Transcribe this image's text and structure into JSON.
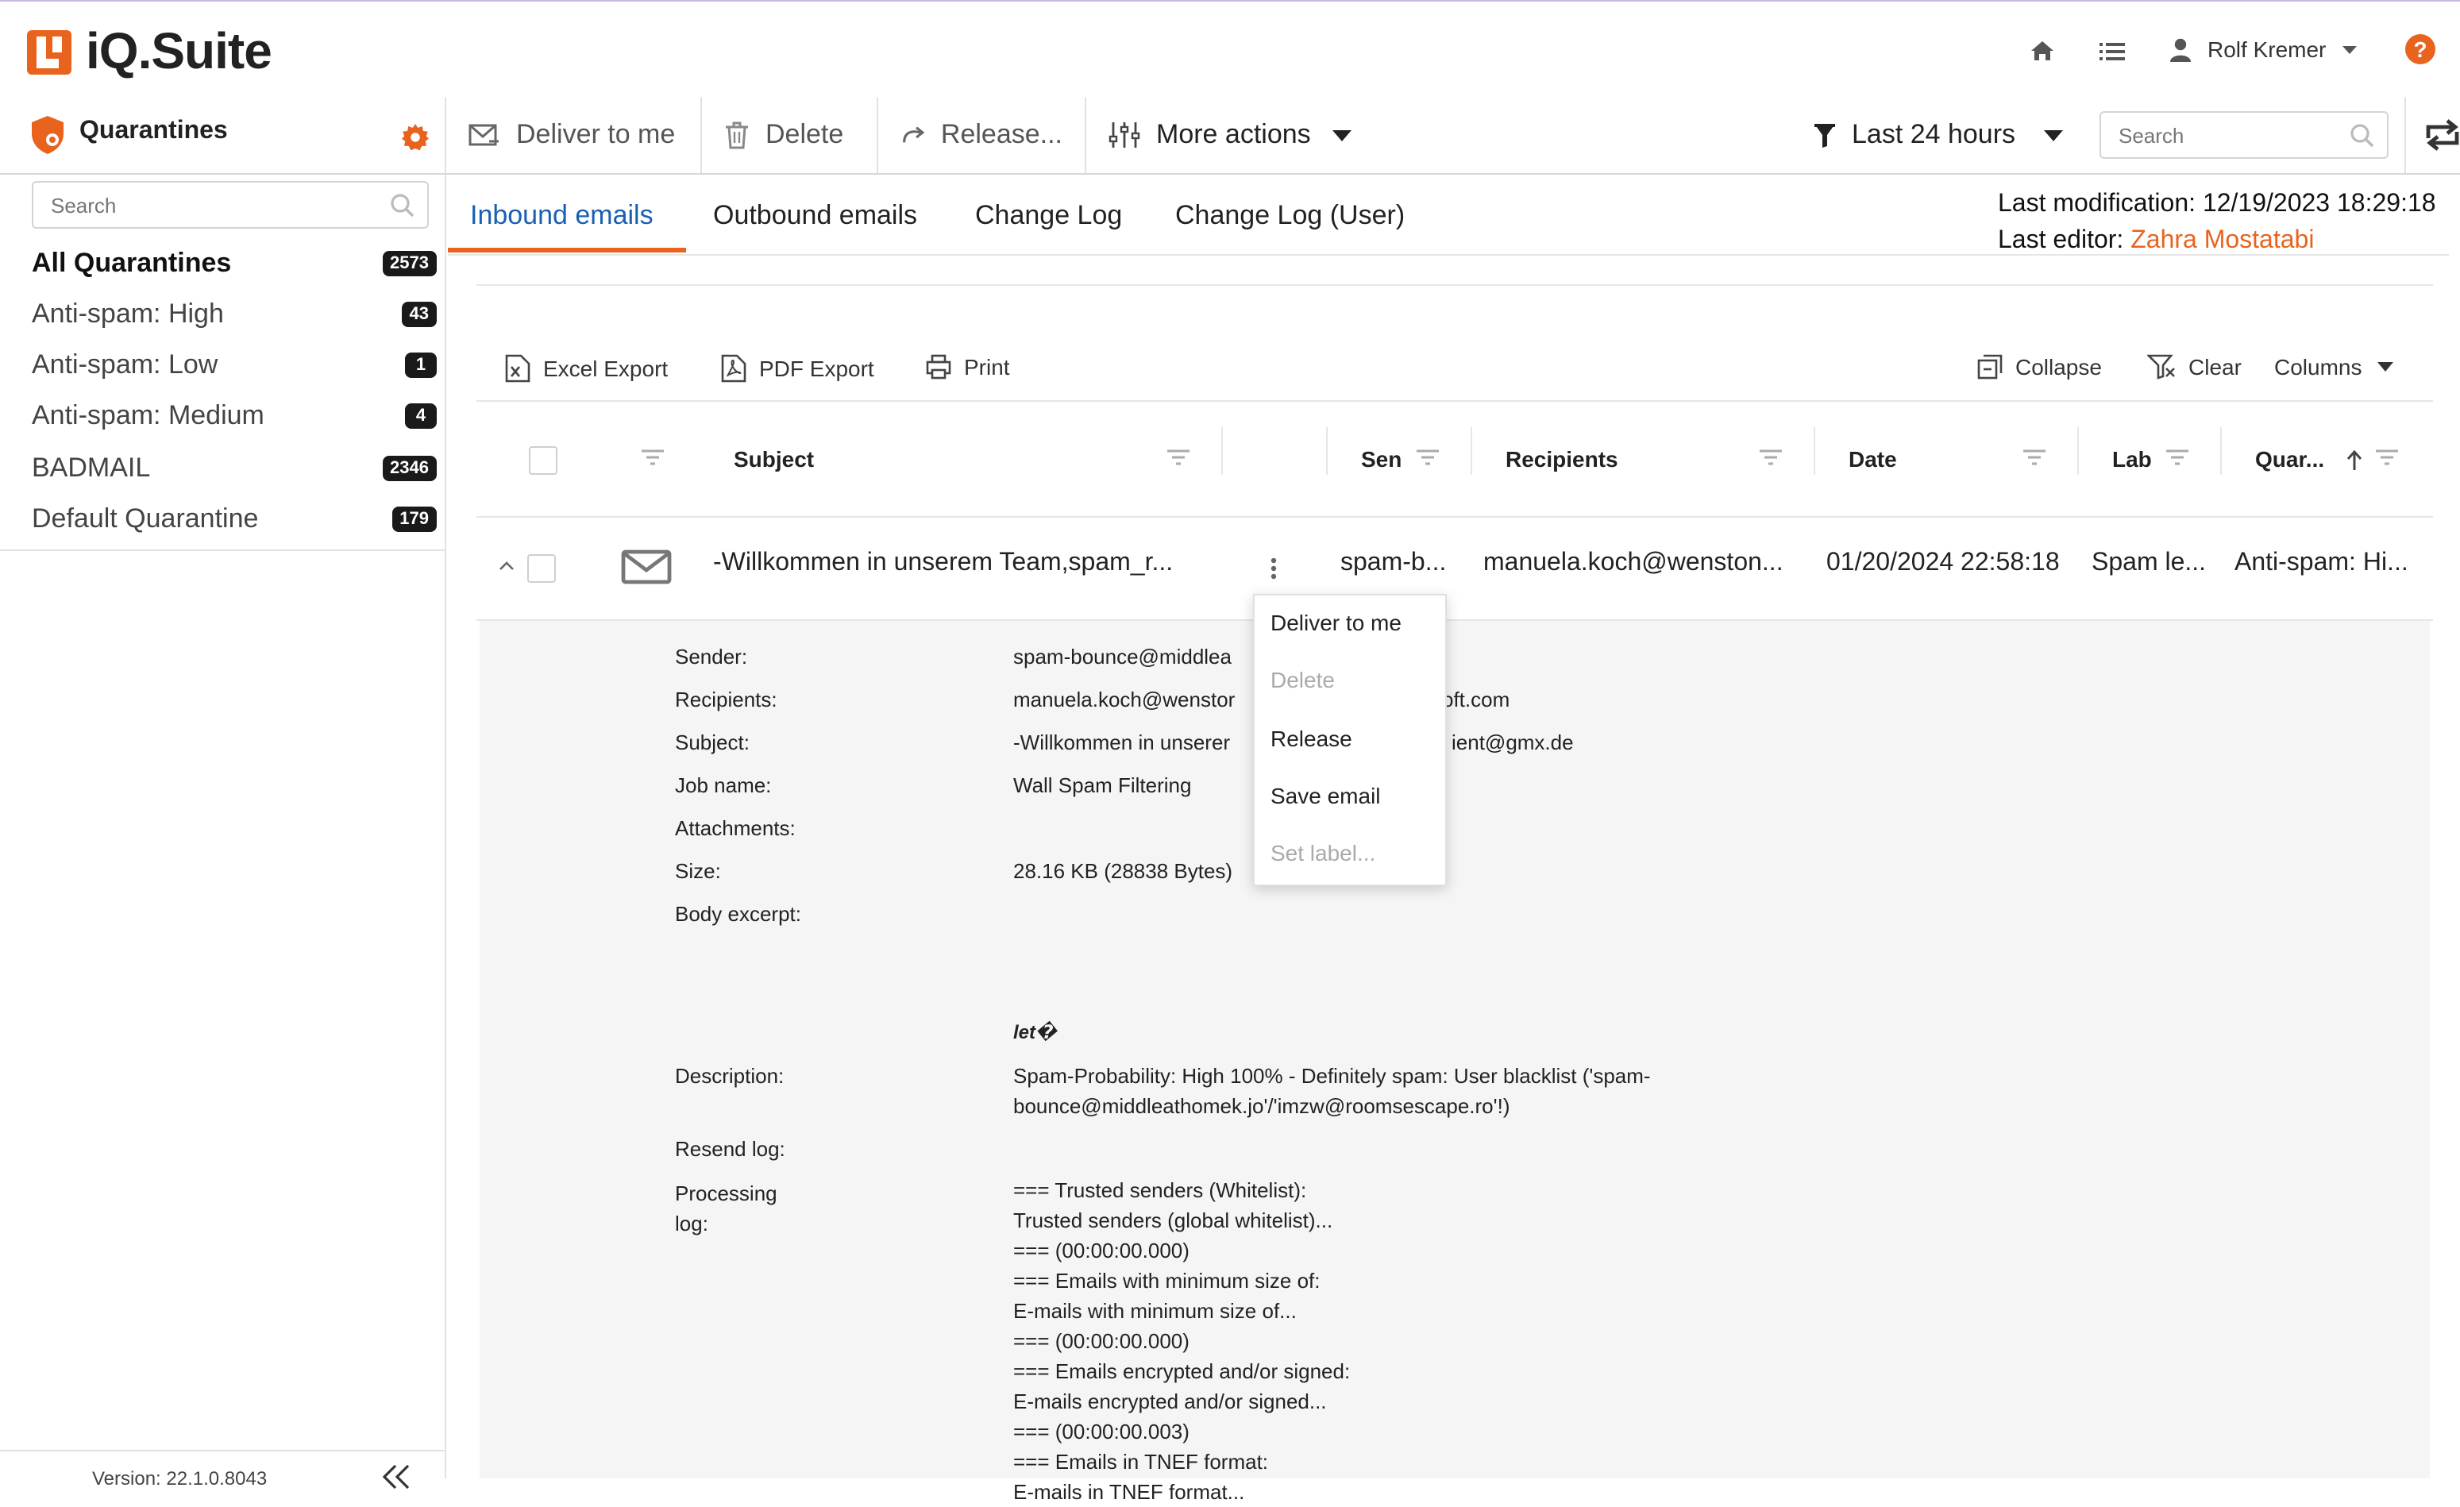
{
  "app": {
    "logo_text": "iQ.Suite",
    "brand_color": "#e8641e",
    "link_color": "#1a5fb4"
  },
  "topbar": {
    "user_name": "Rolf Kremer",
    "icons": [
      "home-icon",
      "list-icon",
      "user-icon",
      "help-icon"
    ]
  },
  "toolbar": {
    "section_title": "Quarantines",
    "deliver_label": "Deliver to me",
    "delete_label": "Delete",
    "release_label": "Release...",
    "more_actions_label": "More actions",
    "time_filter_label": "Last 24 hours",
    "search_placeholder": "Search"
  },
  "sidebar": {
    "search_placeholder": "Search",
    "items": [
      {
        "label": "All Quarantines",
        "count": "2573"
      },
      {
        "label": "Anti-spam: High",
        "count": "43"
      },
      {
        "label": "Anti-spam: Low",
        "count": "1"
      },
      {
        "label": "Anti-spam: Medium",
        "count": "4"
      },
      {
        "label": "BADMAIL",
        "count": "2346"
      },
      {
        "label": "Default Quarantine",
        "count": "179"
      }
    ],
    "version": "Version: 22.1.0.8043"
  },
  "main": {
    "tabs": [
      "Inbound emails",
      "Outbound emails",
      "Change Log",
      "Change Log (User)"
    ],
    "last_modification_label": "Last modification:",
    "last_modification_value": "12/19/2023 18:29:18",
    "last_editor_label": "Last editor:",
    "last_editor_value": "Zahra Mostatabi",
    "export": {
      "excel": "Excel Export",
      "pdf": "PDF Export",
      "print": "Print",
      "collapse": "Collapse",
      "clear": "Clear",
      "columns": "Columns"
    },
    "columns": [
      "Subject",
      "Sen",
      "Recipients",
      "Date",
      "Lab",
      "Quar..."
    ],
    "row": {
      "subject": "-Willkommen in unserem Team,spam_r...",
      "sender": "spam-b...",
      "recipients": "manuela.koch@wenston...",
      "date": "01/20/2024 22:58:18",
      "label": "Spam le...",
      "quarantine": "Anti-spam: Hi..."
    },
    "details": {
      "sender_label": "Sender:",
      "sender_value": "spam-bounce@middlea",
      "recipients_label": "Recipients:",
      "recipients_value": "manuela.koch@wenstor",
      "recipients_tail": "oft.com",
      "subject_label": "Subject:",
      "subject_value": "-Willkommen in unserer",
      "subject_tail": "ient@gmx.de",
      "jobname_label": "Job name:",
      "jobname_value": "Wall Spam Filtering",
      "attachments_label": "Attachments:",
      "size_label": "Size:",
      "size_value": "28.16 KB (28838 Bytes)",
      "body_label": "Body excerpt:",
      "body_value": "let�",
      "description_label": "Description:",
      "description_line1": "Spam-Probability: High 100% - Definitely spam: User blacklist ('spam-",
      "description_line2": "bounce@middleathomek.jo'/'imzw@roomsescape.ro'!)",
      "resend_label": "Resend log:",
      "processing_label_1": "Processing",
      "processing_label_2": "log:",
      "processing_lines": [
        "=== Trusted senders (Whitelist):",
        "Trusted senders (global whitelist)...",
        "=== (00:00:00.000)",
        "=== Emails with minimum size of:",
        "E-mails with minimum size of...",
        "=== (00:00:00.000)",
        "=== Emails encrypted and/or signed:",
        "E-mails encrypted and/or signed...",
        "=== (00:00:00.003)",
        "=== Emails in TNEF format:",
        "E-mails in TNEF format..."
      ]
    }
  },
  "context_menu": {
    "items": [
      {
        "label": "Deliver to me",
        "enabled": true
      },
      {
        "label": "Delete",
        "enabled": false
      },
      {
        "label": "Release",
        "enabled": true
      },
      {
        "label": "Save email",
        "enabled": true
      },
      {
        "label": "Set label...",
        "enabled": false
      }
    ]
  }
}
